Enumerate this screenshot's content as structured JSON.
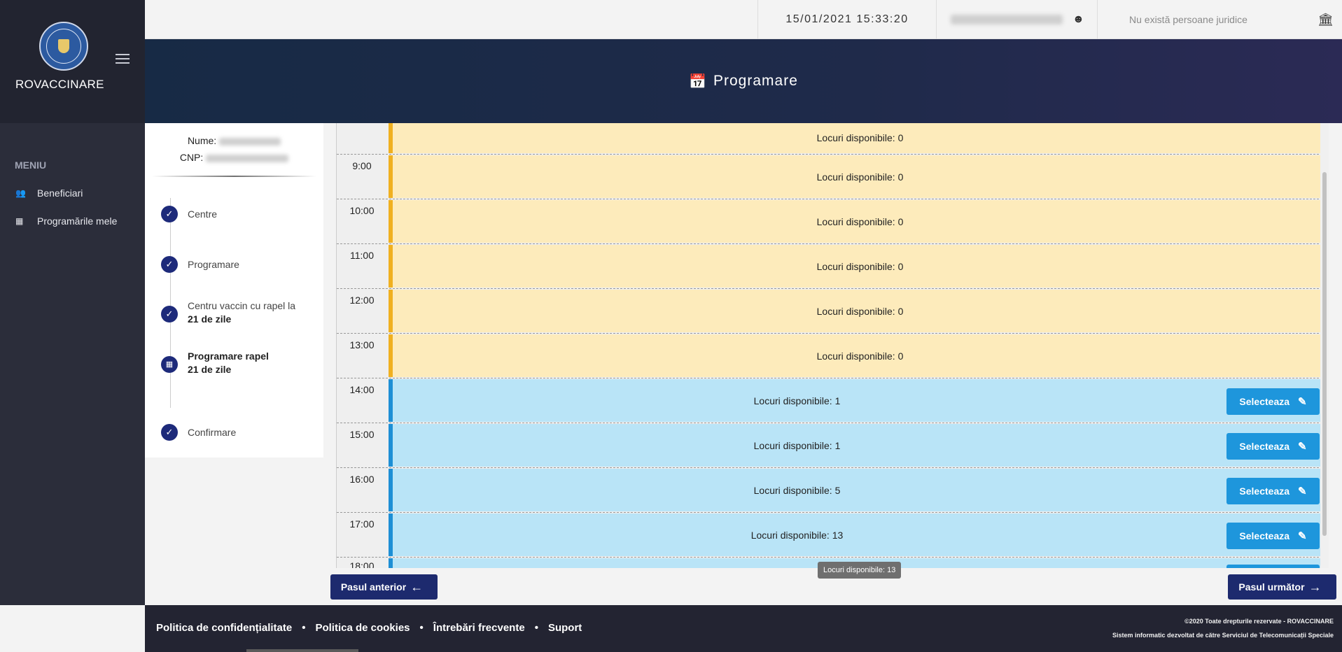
{
  "app": {
    "brand_name": "ROVACCINARE",
    "logo_alt": "Guvernul României"
  },
  "sidebar": {
    "menu_title": "MENIU",
    "items": [
      {
        "label": "Beneficiari",
        "icon": "people-icon"
      },
      {
        "label": "Programările mele",
        "icon": "calendar-icon"
      }
    ]
  },
  "topbar": {
    "datetime": "15/01/2021 15:33:20",
    "legal_entities": "Nu există persoane juridice"
  },
  "banner": {
    "title": "Programare"
  },
  "person": {
    "name_label": "Nume:",
    "cnp_label": "CNP:"
  },
  "steps": [
    {
      "label": "Centre",
      "bold": ""
    },
    {
      "label": "Programare",
      "bold": ""
    },
    {
      "label": "Centru vaccin cu rapel la",
      "bold": "21 de zile"
    },
    {
      "label": "Programare rapel",
      "bold": "21 de zile"
    },
    {
      "label": "Confirmare",
      "bold": ""
    }
  ],
  "schedule": {
    "select_label": "Selecteaza",
    "slots": [
      {
        "time": "",
        "available": "Locuri disponibile: 0"
      },
      {
        "time": "9:00",
        "available": "Locuri disponibile: 0"
      },
      {
        "time": "10:00",
        "available": "Locuri disponibile: 0"
      },
      {
        "time": "11:00",
        "available": "Locuri disponibile: 0"
      },
      {
        "time": "12:00",
        "available": "Locuri disponibile: 0"
      },
      {
        "time": "13:00",
        "available": "Locuri disponibile: 0"
      },
      {
        "time": "14:00",
        "available": "Locuri disponibile: 1"
      },
      {
        "time": "15:00",
        "available": "Locuri disponibile: 1"
      },
      {
        "time": "16:00",
        "available": "Locuri disponibile: 5"
      },
      {
        "time": "17:00",
        "available": "Locuri disponibile: 13"
      },
      {
        "time": "18:00",
        "available": ""
      }
    ]
  },
  "tooltip": "Locuri disponibile: 13",
  "nav": {
    "prev": "Pasul anterior",
    "next": "Pasul următor"
  },
  "footer": {
    "links": [
      "Politica de confidențialitate",
      "Politica de cookies",
      "Întrebări frecvente",
      "Suport"
    ],
    "copyright": "©2020 Toate drepturile rezervate - ROVACCINARE",
    "developer": "Sistem informatic dezvoltat de către Serviciul de Telecomunicații Speciale"
  },
  "colors": {
    "full_slot": "#fdebbb",
    "open_slot": "#b9e4f7",
    "select_button": "#1e96dc",
    "nav_button": "#1d2a6e"
  }
}
